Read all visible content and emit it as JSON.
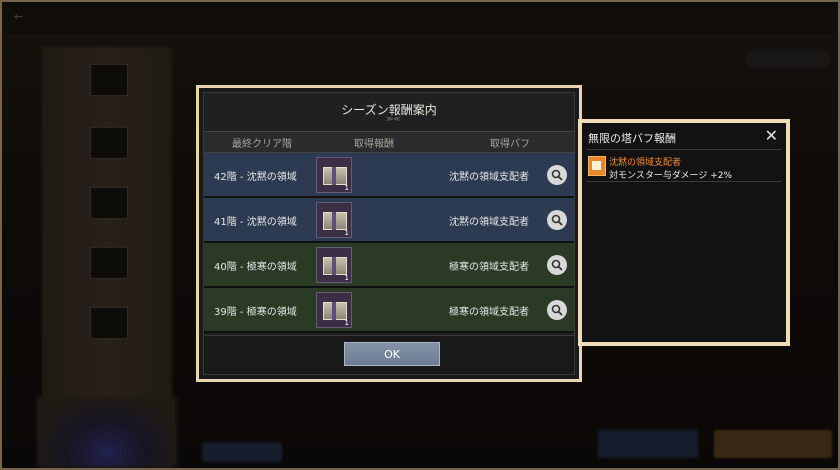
{
  "modal": {
    "title": "シーズン報酬案内",
    "columns": [
      "最終クリア階",
      "取得報酬",
      "取得バフ"
    ],
    "rows": [
      {
        "floor": "42階 - 沈黙の領域",
        "count": "1",
        "buff": "沈黙の領域支配者",
        "theme": "blue"
      },
      {
        "floor": "41階 - 沈黙の領域",
        "count": "1",
        "buff": "沈黙の領域支配者",
        "theme": "blue"
      },
      {
        "floor": "40階 - 極寒の領域",
        "count": "1",
        "buff": "極寒の領域支配者",
        "theme": "green"
      },
      {
        "floor": "39階 - 極寒の領域",
        "count": "1",
        "buff": "極寒の領域支配者",
        "theme": "green"
      }
    ],
    "ok_label": "OK"
  },
  "panel": {
    "title": "無限の塔バフ報酬",
    "buff_name": "沈黙の領域支配者",
    "buff_effect": "対モンスター与ダメージ +2%"
  },
  "icons": {
    "magnifier": "magnifier-icon",
    "close": "close-icon",
    "chest": "reward-chest-icon",
    "buff": "buff-icon"
  },
  "colors": {
    "frame": "#e9d6b1",
    "row_blue": "#2d3b52",
    "row_green": "#2b3a25",
    "buff_name": "#ef8a3a",
    "ok_button": "#7a889d"
  }
}
